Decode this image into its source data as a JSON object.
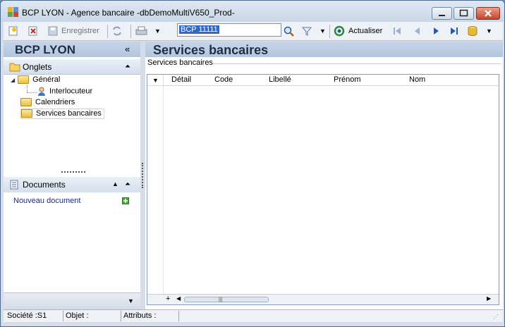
{
  "window": {
    "title": "BCP LYON -  Agence bancaire -dbDemoMultiV650_Prod-"
  },
  "toolbar": {
    "save_label": "Enregistrer",
    "search_value": "BCP 11111",
    "refresh_label": "Actualiser"
  },
  "left_panel": {
    "header": "BCP LYON",
    "collapse_glyph": "«",
    "onglets": {
      "title": "Onglets",
      "items": [
        {
          "label": "Général"
        },
        {
          "label": "Interlocuteur"
        },
        {
          "label": "Calendriers"
        },
        {
          "label": "Services bancaires"
        }
      ]
    },
    "documents": {
      "title": "Documents",
      "new_document": "Nouveau document"
    }
  },
  "main": {
    "title": "Services bancaires",
    "group_label": "Services bancaires",
    "columns": [
      "Détail",
      "Code",
      "Libellé",
      "Prénom",
      "Nom"
    ],
    "rows": []
  },
  "statusbar": {
    "societe": "Société :S1",
    "objet": "Objet :",
    "attributs": "Attributs :"
  },
  "colors": {
    "accent": "#3169c6",
    "header_bg": "#b3c6de",
    "close": "#c8442a"
  }
}
